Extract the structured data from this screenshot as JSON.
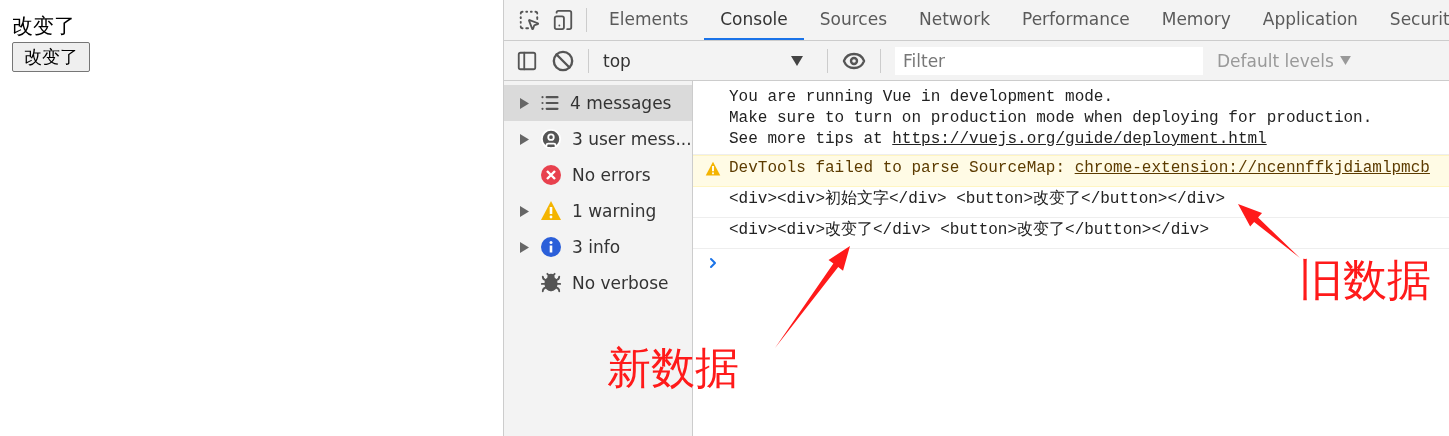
{
  "page": {
    "text": "改变了",
    "button": "改变了"
  },
  "devtools": {
    "tabs": [
      {
        "label": "Elements",
        "selected": false
      },
      {
        "label": "Console",
        "selected": true
      },
      {
        "label": "Sources",
        "selected": false
      },
      {
        "label": "Network",
        "selected": false
      },
      {
        "label": "Performance",
        "selected": false
      },
      {
        "label": "Memory",
        "selected": false
      },
      {
        "label": "Application",
        "selected": false
      },
      {
        "label": "Securit",
        "selected": false
      }
    ],
    "toolbar": {
      "context": "top",
      "filter_placeholder": "Filter",
      "levels": "Default levels"
    },
    "sidebar": [
      {
        "kind": "messages",
        "label": "4 messages",
        "expandable": true,
        "selected": true
      },
      {
        "kind": "user",
        "label": "3 user mess...",
        "expandable": true,
        "selected": false
      },
      {
        "kind": "error",
        "label": "No errors",
        "expandable": false,
        "selected": false
      },
      {
        "kind": "warning",
        "label": "1 warning",
        "expandable": true,
        "selected": false
      },
      {
        "kind": "info",
        "label": "3 info",
        "expandable": true,
        "selected": false
      },
      {
        "kind": "verbose",
        "label": "No verbose",
        "expandable": false,
        "selected": false
      }
    ],
    "console": [
      {
        "kind": "log",
        "lines": [
          {
            "text": "You are running Vue in development mode."
          },
          {
            "text": "Make sure to turn on production mode when deploying for production."
          },
          {
            "text": "See more tips at ",
            "link": "https://vuejs.org/guide/deployment.html"
          }
        ]
      },
      {
        "kind": "warning",
        "lines": [
          {
            "text": "DevTools failed to parse SourceMap: ",
            "link": "chrome-extension://ncennffkjdiamlpmcb"
          }
        ]
      },
      {
        "kind": "log",
        "lines": [
          {
            "text": "<div><div>初始文字</div> <button>改变了</button></div>"
          }
        ]
      },
      {
        "kind": "log",
        "lines": [
          {
            "text": "<div><div>改变了</div> <button>改变了</button></div>"
          }
        ]
      }
    ],
    "annotations": [
      {
        "text": "旧数据"
      },
      {
        "text": "新数据"
      }
    ]
  }
}
